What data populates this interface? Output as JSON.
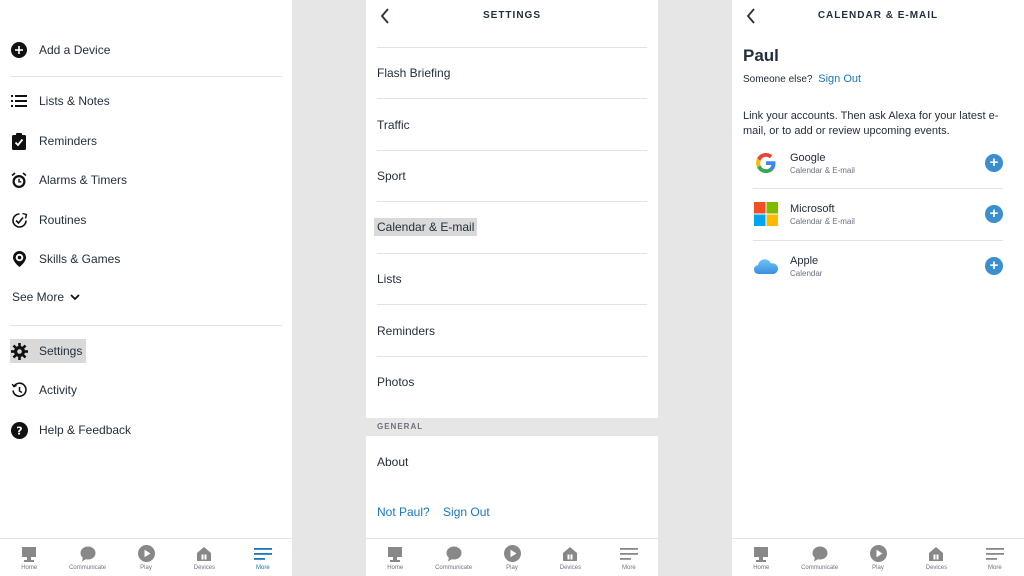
{
  "more_menu": {
    "items_top": [
      {
        "label": "Add a Device",
        "icon": "plus-circle-icon"
      }
    ],
    "items_main": [
      {
        "label": "Lists & Notes",
        "icon": "list-icon"
      },
      {
        "label": "Reminders",
        "icon": "clipboard-icon"
      },
      {
        "label": "Alarms & Timers",
        "icon": "alarm-clock-icon"
      },
      {
        "label": "Routines",
        "icon": "routines-icon"
      },
      {
        "label": "Skills & Games",
        "icon": "skills-icon"
      }
    ],
    "see_more": "See More",
    "items_bottom": [
      {
        "label": "Settings",
        "icon": "gear-icon",
        "selected": true
      },
      {
        "label": "Activity",
        "icon": "history-icon"
      },
      {
        "label": "Help & Feedback",
        "icon": "help-icon"
      }
    ]
  },
  "settings": {
    "title": "SETTINGS",
    "rows": [
      {
        "label": "Flash Briefing"
      },
      {
        "label": "Traffic"
      },
      {
        "label": "Sport"
      },
      {
        "label": "Calendar & E-mail",
        "selected": true
      },
      {
        "label": "Lists"
      },
      {
        "label": "Reminders"
      },
      {
        "label": "Photos"
      }
    ],
    "section_general": "GENERAL",
    "about": "About",
    "not_user": "Not Paul?",
    "sign_out": "Sign Out"
  },
  "calendar": {
    "title": "CALENDAR & E-MAIL",
    "user_name": "Paul",
    "someone_else": "Someone else?",
    "sign_out": "Sign Out",
    "description": "Link your accounts. Then ask Alexa for your latest e-mail, or to add or review upcoming events.",
    "accounts": [
      {
        "name": "Google",
        "sub": "Calendar & E-mail",
        "logo": "google-logo-icon"
      },
      {
        "name": "Microsoft",
        "sub": "Calendar & E-mail",
        "logo": "microsoft-logo-icon"
      },
      {
        "name": "Apple",
        "sub": "Calendar",
        "logo": "icloud-logo-icon"
      }
    ],
    "add_symbol": "+"
  },
  "tabbar": [
    {
      "label": "Home",
      "icon": "home-icon"
    },
    {
      "label": "Communicate",
      "icon": "chat-bubble-icon"
    },
    {
      "label": "Play",
      "icon": "play-icon"
    },
    {
      "label": "Devices",
      "icon": "devices-icon"
    },
    {
      "label": "More",
      "icon": "menu-icon"
    }
  ],
  "colors": {
    "accent": "#1b75bb",
    "plus_button": "#3b8fd0",
    "text": "#232f3e",
    "selected_bg": "#d9d9d9",
    "gap_bg": "#e6e6e6"
  }
}
